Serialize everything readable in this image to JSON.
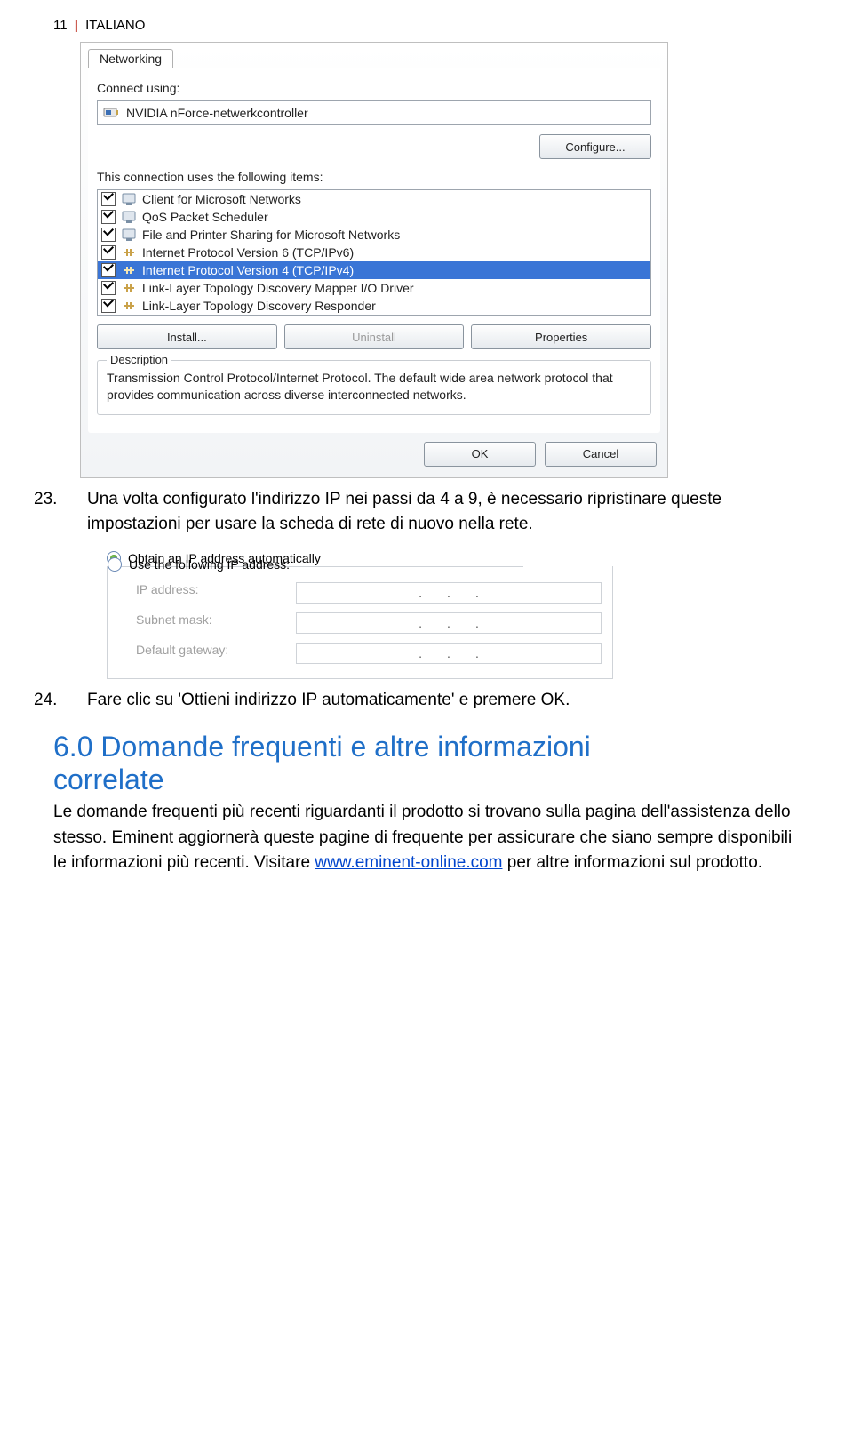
{
  "header": {
    "page_num": "11",
    "lang": "ITALIANO"
  },
  "dialog": {
    "tab": "Networking",
    "connect_using_label": "Connect using:",
    "adapter": "NVIDIA nForce-netwerkcontroller",
    "configure_btn": "Configure...",
    "items_label": "This connection uses the following items:",
    "items": [
      "Client for Microsoft Networks",
      "QoS Packet Scheduler",
      "File and Printer Sharing for Microsoft Networks",
      "Internet Protocol Version 6 (TCP/IPv6)",
      "Internet Protocol Version 4 (TCP/IPv4)",
      "Link-Layer Topology Discovery Mapper I/O Driver",
      "Link-Layer Topology Discovery Responder"
    ],
    "install_btn": "Install...",
    "uninstall_btn": "Uninstall",
    "properties_btn": "Properties",
    "desc_legend": "Description",
    "desc_text": "Transmission Control Protocol/Internet Protocol. The default wide area network protocol that provides communication across diverse interconnected networks.",
    "ok_btn": "OK",
    "cancel_btn": "Cancel"
  },
  "step23": {
    "num": "23.",
    "text": "Una volta configurato l'indirizzo IP nei passi da 4 a 9, è necessario ripristinare queste impostazioni per usare la scheda di rete di nuovo nella rete."
  },
  "ip": {
    "radio_auto": "Obtain an IP address automatically",
    "radio_manual": "Use the following IP address:",
    "ip_label": "IP address:",
    "subnet_label": "Subnet mask:",
    "gateway_label": "Default gateway:"
  },
  "step24": {
    "num": "24.",
    "text": "Fare clic su 'Ottieni indirizzo IP automaticamente' e premere OK."
  },
  "section": {
    "title_line1": "6.0 Domande frequenti e altre informazioni",
    "title_line2": "correlate",
    "para_before_link": "Le domande frequenti più recenti riguardanti il prodotto si trovano sulla pagina dell'assistenza dello stesso. Eminent aggiornerà queste pagine di frequente per assicurare che siano sempre disponibili le informazioni più recenti. Visitare ",
    "link_text": "www.eminent-online.com",
    "para_after_link": " per altre informazioni sul prodotto."
  }
}
